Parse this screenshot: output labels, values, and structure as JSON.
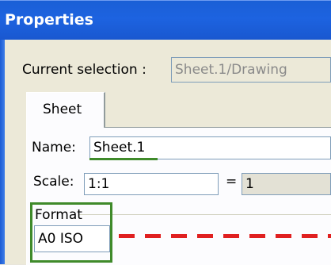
{
  "window": {
    "title": "Properties"
  },
  "current_selection": {
    "label": "Current selection :",
    "value": "Sheet.1/Drawing"
  },
  "tabs": [
    {
      "label": "Sheet"
    }
  ],
  "sheet": {
    "name_label": "Name:",
    "name_value": "Sheet.1",
    "scale_label": "Scale:",
    "scale_value": "1:1",
    "equals": "=",
    "scale_result": "1",
    "format_group_label": "Format",
    "format_value": "A0 ISO"
  },
  "annotations": {
    "highlight_color": "#3f8a2a",
    "dash_color": "#e02020"
  }
}
